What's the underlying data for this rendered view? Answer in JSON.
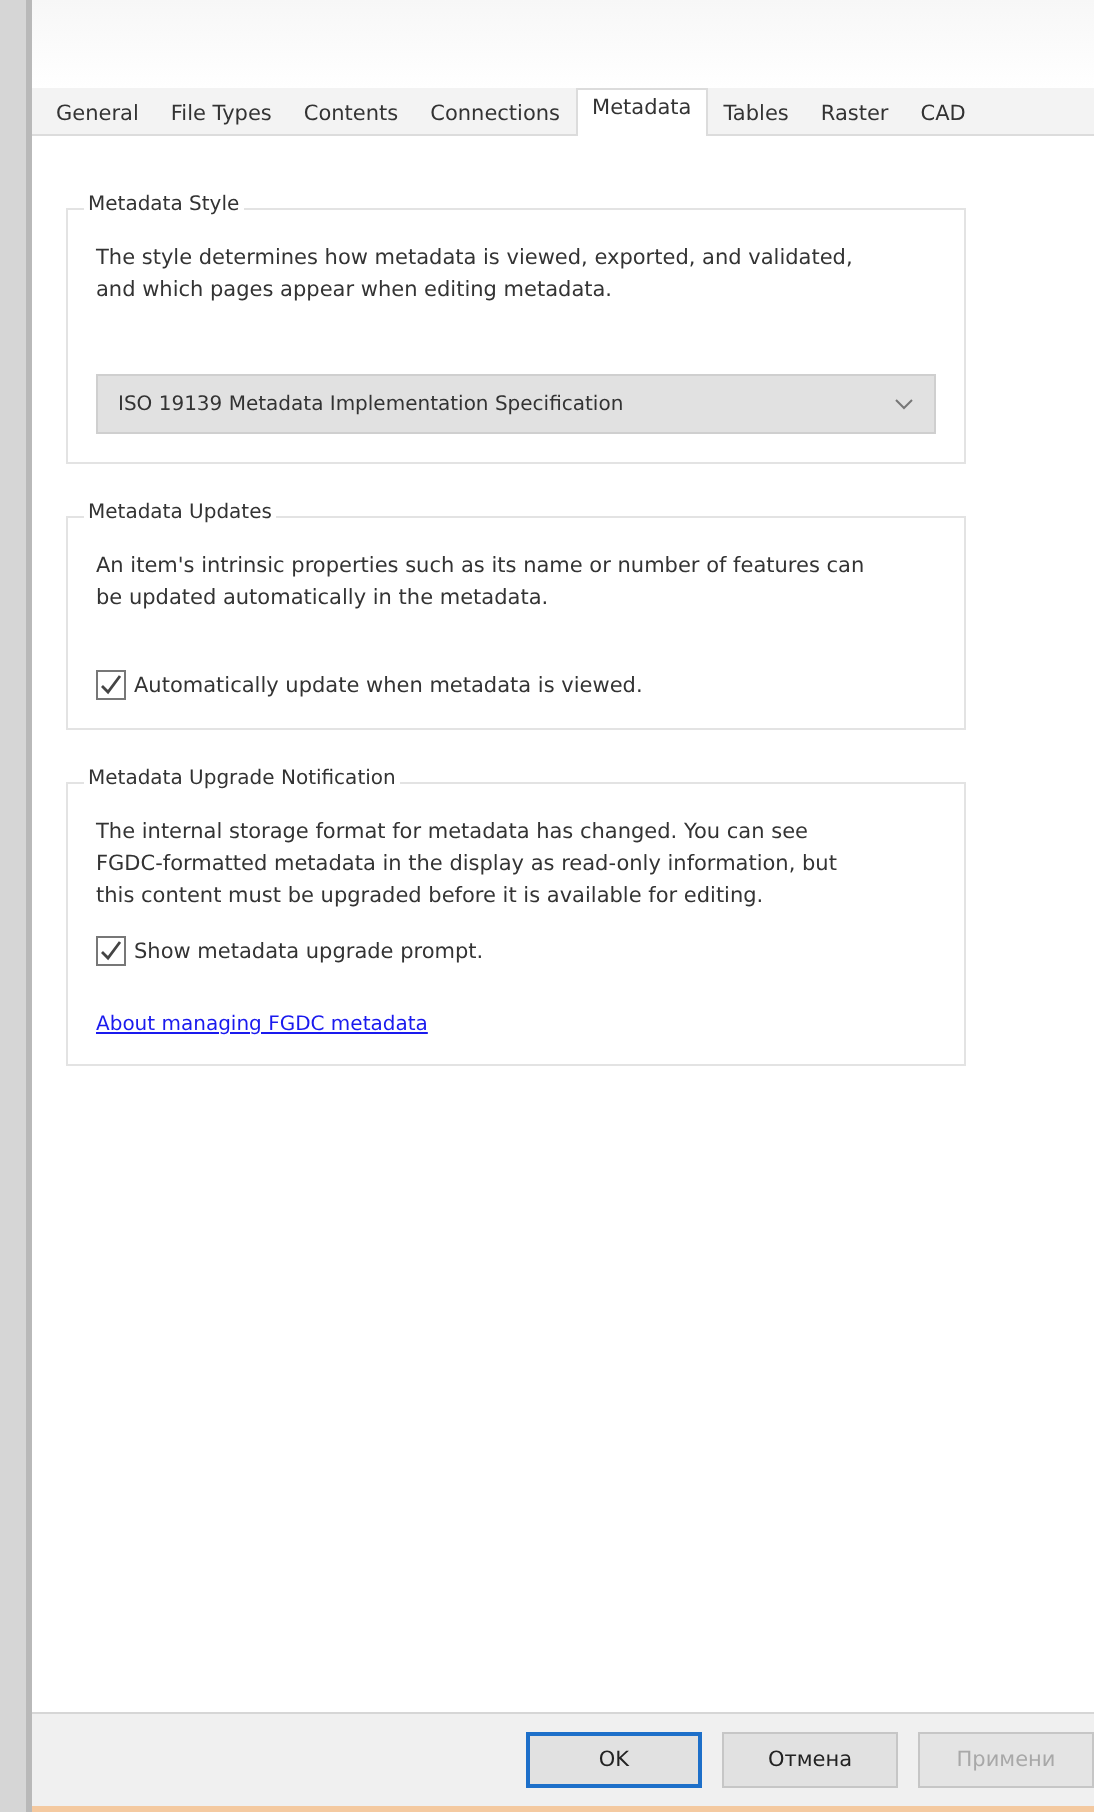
{
  "tabs": [
    {
      "label": "General",
      "selected": false
    },
    {
      "label": "File Types",
      "selected": false
    },
    {
      "label": "Contents",
      "selected": false
    },
    {
      "label": "Connections",
      "selected": false
    },
    {
      "label": "Metadata",
      "selected": true
    },
    {
      "label": "Tables",
      "selected": false
    },
    {
      "label": "Raster",
      "selected": false
    },
    {
      "label": "CAD",
      "selected": false
    }
  ],
  "groups": [
    {
      "title": "Metadata Style",
      "description": "The style determines how metadata is viewed, exported, and validated, and which pages appear when editing metadata.",
      "dropdown": {
        "value": "ISO 19139 Metadata Implementation Specification"
      }
    },
    {
      "title": "Metadata Updates",
      "description": "An item's intrinsic properties such as its name or number of features can be updated automatically in the metadata.",
      "checkbox": {
        "label": "Automatically update when metadata is viewed.",
        "checked": true
      }
    },
    {
      "title": "Metadata Upgrade Notification",
      "description": "The internal storage format for metadata has changed. You can see FGDC-formatted metadata in the display as read-only information, but this content must be upgraded before it is available for editing.",
      "checkbox": {
        "label": "Show metadata upgrade prompt.",
        "checked": true
      },
      "link": "About managing FGDC metadata"
    }
  ],
  "buttons": [
    {
      "label": "OK",
      "disabled": false,
      "default": true
    },
    {
      "label": "Отмена",
      "disabled": false,
      "default": false
    },
    {
      "label": "Примени",
      "disabled": true,
      "default": false
    }
  ]
}
